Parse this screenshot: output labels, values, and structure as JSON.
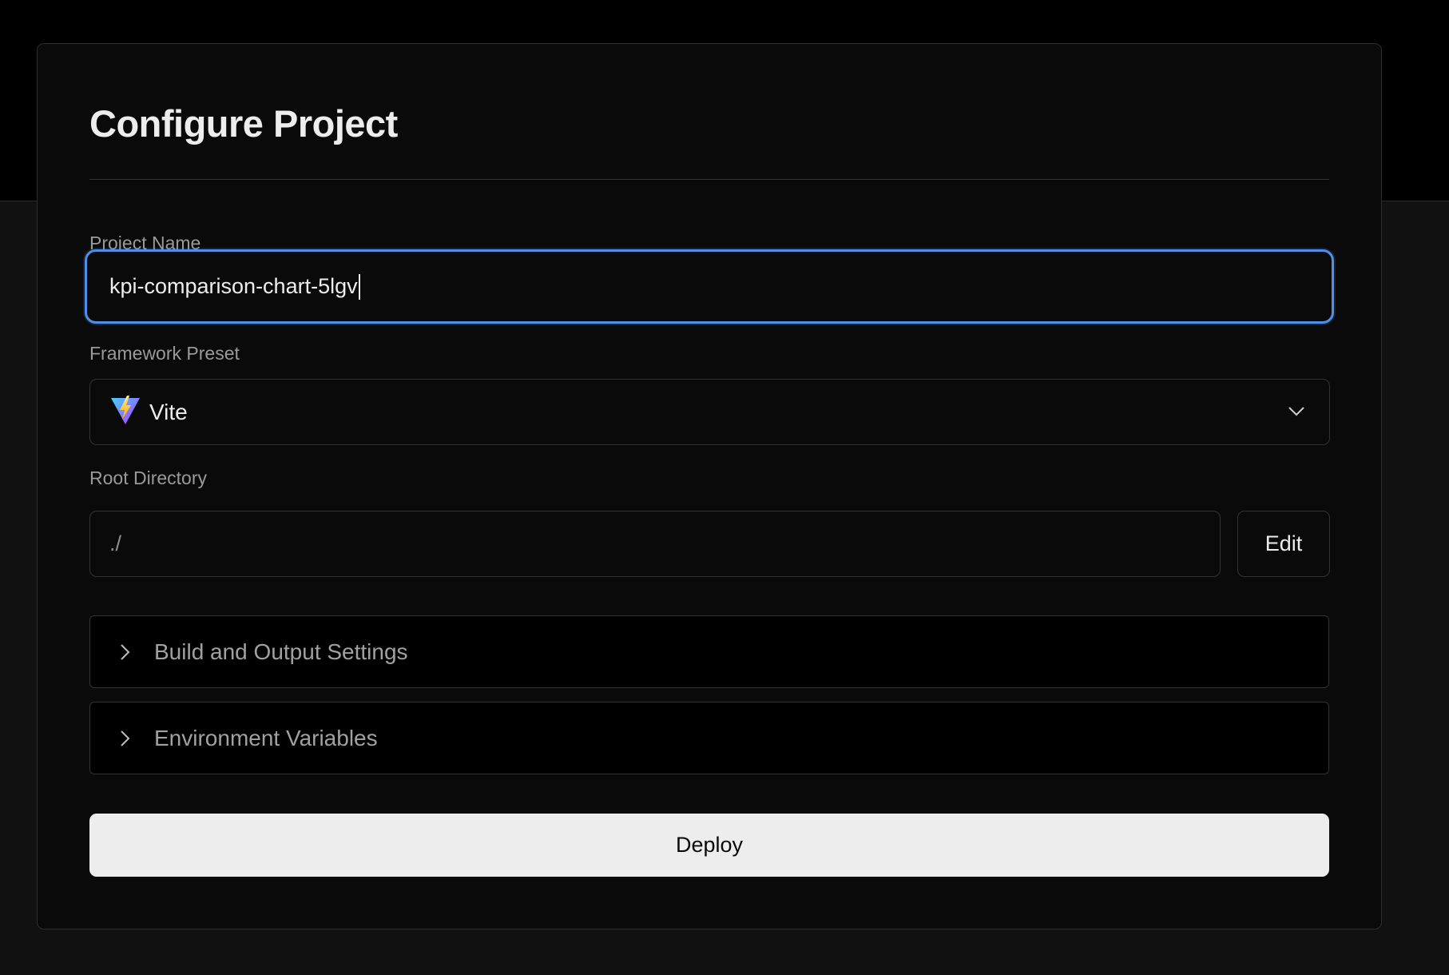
{
  "page": {
    "title": "Configure Project"
  },
  "project_name": {
    "label": "Project Name",
    "value": "kpi-comparison-chart-5lgv"
  },
  "framework_preset": {
    "label": "Framework Preset",
    "selected": "Vite",
    "icon": "vite-logo-icon"
  },
  "root_directory": {
    "label": "Root Directory",
    "value": "./",
    "edit_label": "Edit"
  },
  "sections": {
    "build": "Build and Output Settings",
    "env": "Environment Variables"
  },
  "actions": {
    "deploy_label": "Deploy"
  },
  "colors": {
    "focus_ring": "#4f8fe6",
    "background": "#0a0a0a",
    "primary_button": "#ededed"
  }
}
